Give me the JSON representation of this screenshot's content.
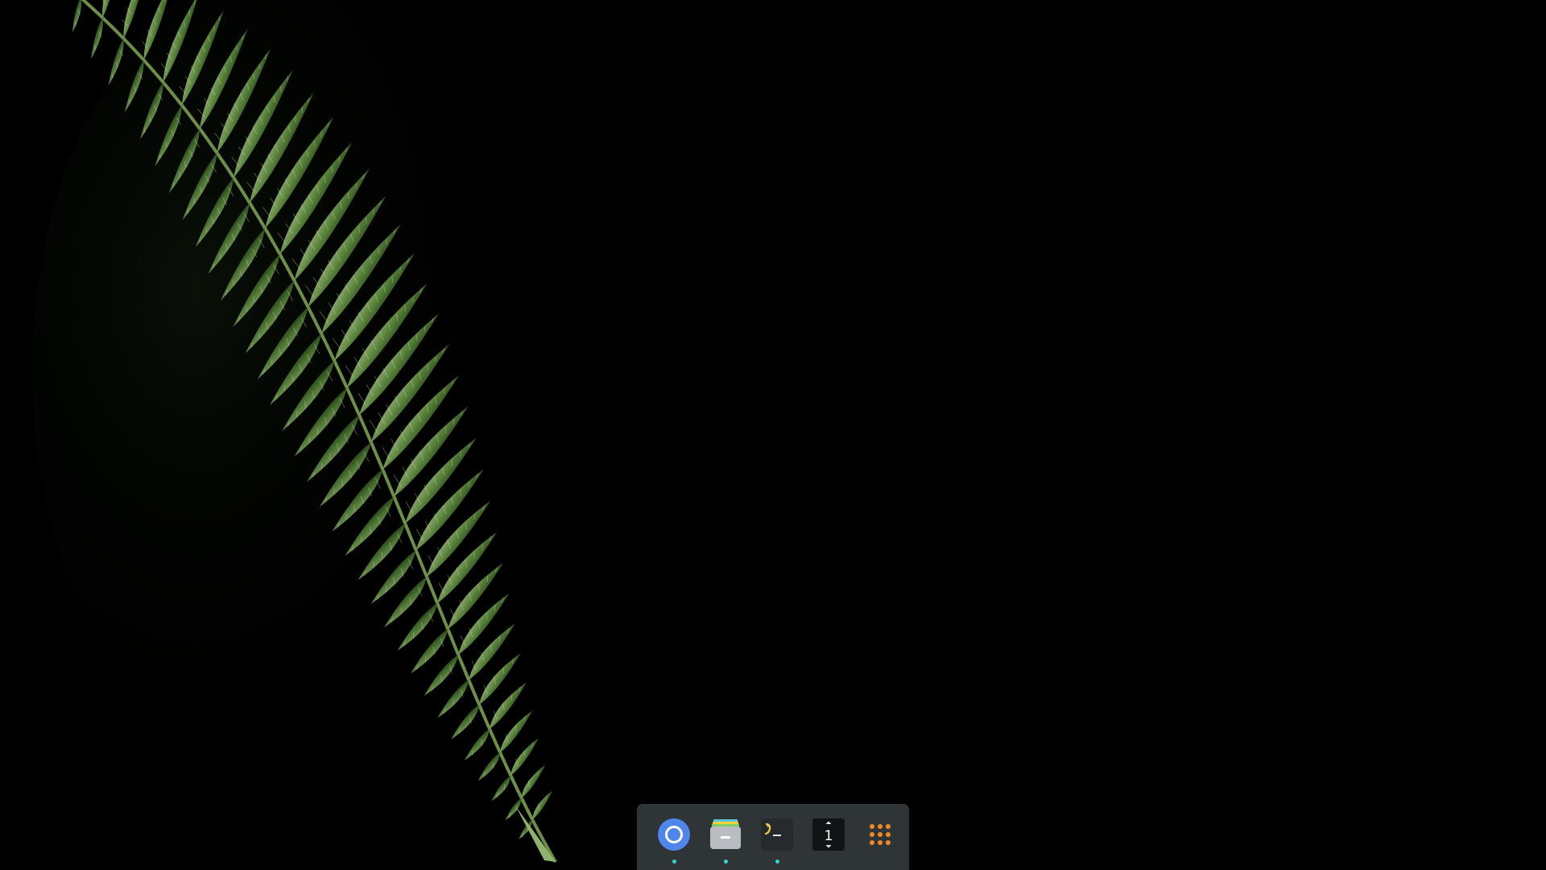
{
  "desktop": {
    "wallpaper_icon": "fern-wallpaper",
    "background_color": "#000000"
  },
  "dock": {
    "background_color": "#2f3437",
    "indicator_color": "#33d6c9",
    "items": [
      {
        "icon": "chrome-browser-icon",
        "running": true
      },
      {
        "icon": "files-app-icon",
        "running": true
      },
      {
        "icon": "terminal-app-icon",
        "running": true
      },
      {
        "icon": "workspace-switcher-icon",
        "label": "1",
        "running": false
      },
      {
        "icon": "app-grid-icon",
        "running": false
      }
    ]
  }
}
